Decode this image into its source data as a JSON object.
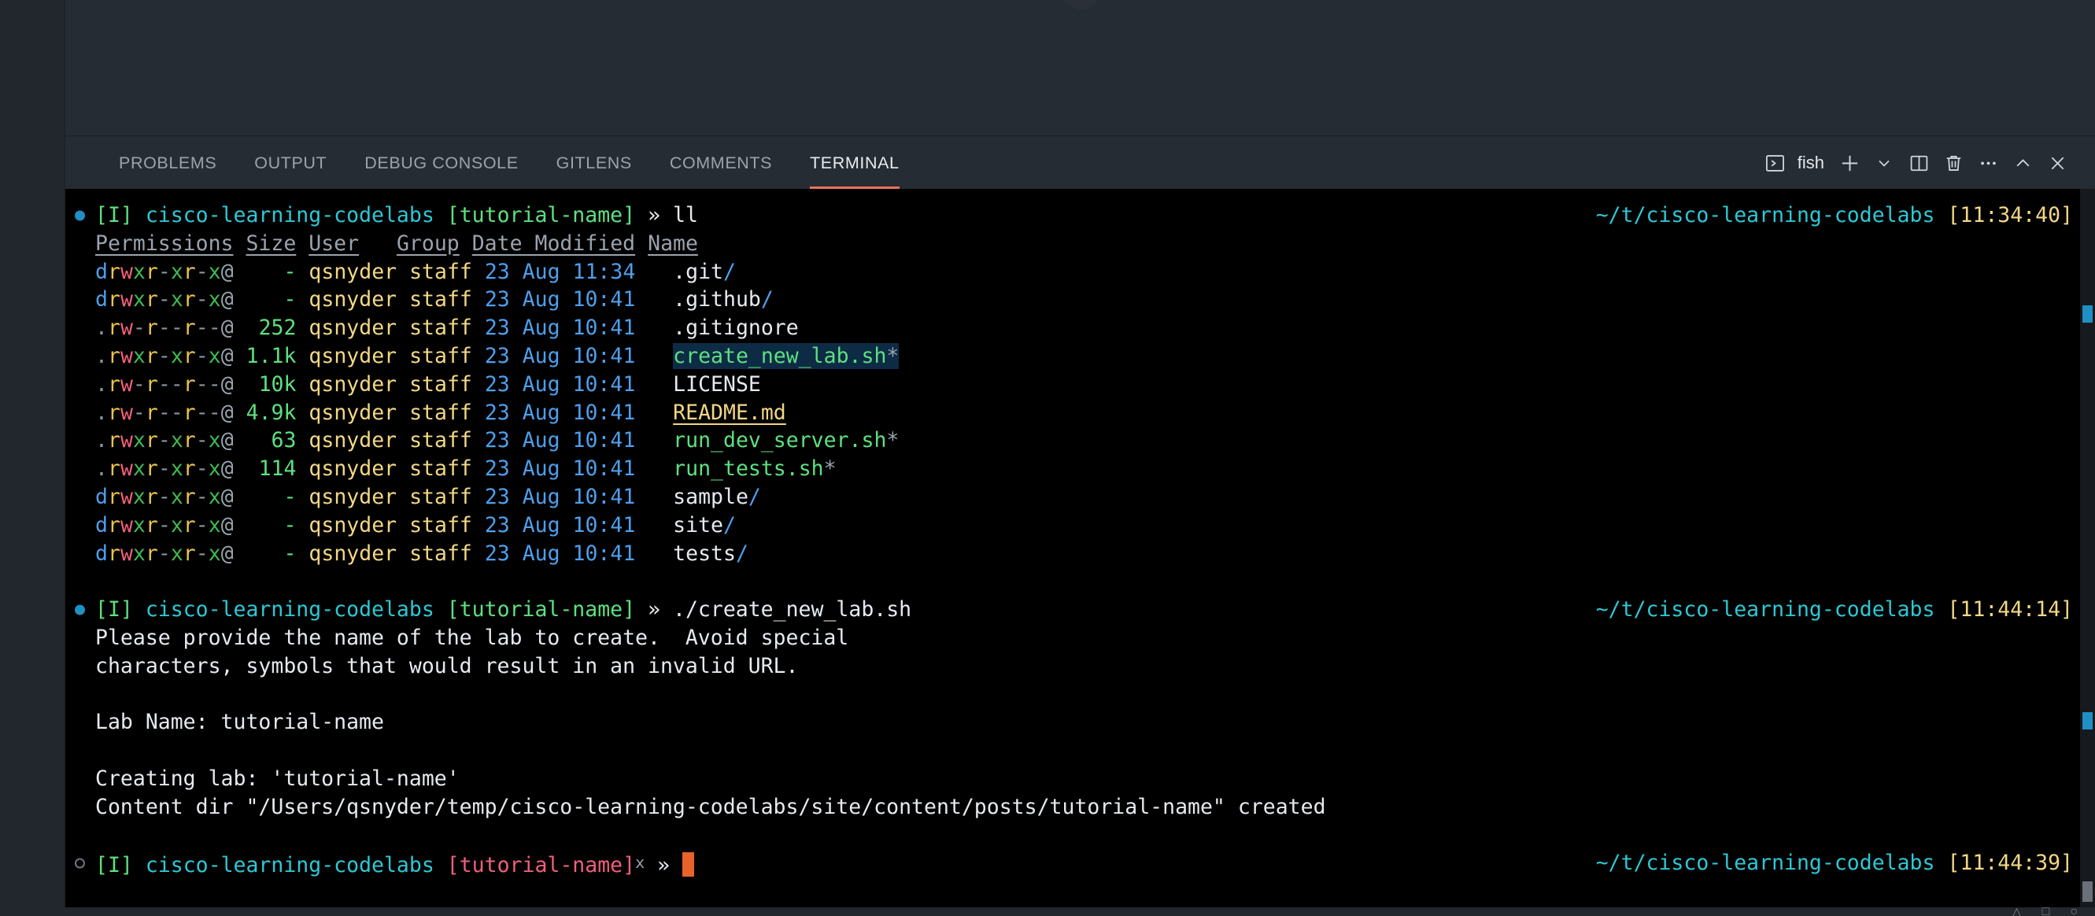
{
  "window": {
    "theme_bg": "#22272e",
    "panel_bg": "#262c33",
    "terminal_bg": "#000000",
    "accent": "#e8765a"
  },
  "panel": {
    "tabs": [
      {
        "label": "PROBLEMS",
        "active": false
      },
      {
        "label": "OUTPUT",
        "active": false
      },
      {
        "label": "DEBUG CONSOLE",
        "active": false
      },
      {
        "label": "GITLENS",
        "active": false
      },
      {
        "label": "COMMENTS",
        "active": false
      },
      {
        "label": "TERMINAL",
        "active": true
      }
    ],
    "actions": {
      "shell_label": "fish",
      "shell_icon": "terminal-icon",
      "new_terminal_icon": "plus-icon",
      "new_terminal_dropdown_icon": "chevron-down-icon",
      "split_terminal_icon": "split-editor-icon",
      "kill_terminal_icon": "trash-icon",
      "more_actions_icon": "ellipsis-icon",
      "maximize_panel_icon": "chevron-up-icon",
      "close_panel_icon": "close-icon"
    }
  },
  "terminal": {
    "prompt": {
      "mode": "[I]",
      "repo": "cisco-learning-codelabs",
      "branch_clean": "[tutorial-name]",
      "branch_dirty": "[tutorial-name]",
      "branch_dirty_mark": "x",
      "arrow": "»",
      "cwd": "~/t/cisco-learning-codelabs"
    },
    "blocks": [
      {
        "command": "ll",
        "timestamp": "[11:34:40]",
        "status": "done",
        "table": {
          "headers": [
            "Permissions",
            "Size",
            "User",
            "Group",
            "Date Modified",
            "Name"
          ],
          "rows": [
            {
              "perm": "drwxr-xr-x@",
              "size": "-",
              "user": "qsnyder",
              "group": "staff",
              "date": "23 Aug 11:34",
              "name": ".git",
              "kind": "dir"
            },
            {
              "perm": "drwxr-xr-x@",
              "size": "-",
              "user": "qsnyder",
              "group": "staff",
              "date": "23 Aug 10:41",
              "name": ".github",
              "kind": "dir"
            },
            {
              "perm": ".rw-r--r--@",
              "size": "252",
              "user": "qsnyder",
              "group": "staff",
              "date": "23 Aug 10:41",
              "name": ".gitignore",
              "kind": "file"
            },
            {
              "perm": ".rwxr-xr-x@",
              "size": "1.1k",
              "user": "qsnyder",
              "group": "staff",
              "date": "23 Aug 10:41",
              "name": "create_new_lab.sh",
              "kind": "exec",
              "selected": true
            },
            {
              "perm": ".rw-r--r--@",
              "size": "10k",
              "user": "qsnyder",
              "group": "staff",
              "date": "23 Aug 10:41",
              "name": "LICENSE",
              "kind": "file"
            },
            {
              "perm": ".rw-r--r--@",
              "size": "4.9k",
              "user": "qsnyder",
              "group": "staff",
              "date": "23 Aug 10:41",
              "name": "README.md",
              "kind": "link"
            },
            {
              "perm": ".rwxr-xr-x@",
              "size": "63",
              "user": "qsnyder",
              "group": "staff",
              "date": "23 Aug 10:41",
              "name": "run_dev_server.sh",
              "kind": "exec"
            },
            {
              "perm": ".rwxr-xr-x@",
              "size": "114",
              "user": "qsnyder",
              "group": "staff",
              "date": "23 Aug 10:41",
              "name": "run_tests.sh",
              "kind": "exec"
            },
            {
              "perm": "drwxr-xr-x@",
              "size": "-",
              "user": "qsnyder",
              "group": "staff",
              "date": "23 Aug 10:41",
              "name": "sample",
              "kind": "dir"
            },
            {
              "perm": "drwxr-xr-x@",
              "size": "-",
              "user": "qsnyder",
              "group": "staff",
              "date": "23 Aug 10:41",
              "name": "site",
              "kind": "dir"
            },
            {
              "perm": "drwxr-xr-x@",
              "size": "-",
              "user": "qsnyder",
              "group": "staff",
              "date": "23 Aug 10:41",
              "name": "tests",
              "kind": "dir"
            }
          ]
        }
      },
      {
        "command": "./create_new_lab.sh",
        "timestamp": "[11:44:14]",
        "status": "done",
        "output": [
          "Please provide the name of the lab to create.  Avoid special",
          "characters, symbols that would result in an invalid URL.",
          "",
          "Lab Name: tutorial-name",
          "",
          "Creating lab: 'tutorial-name'",
          "Content dir \"/Users/qsnyder/temp/cisco-learning-codelabs/site/content/posts/tutorial-name\" created"
        ]
      },
      {
        "command": "",
        "timestamp": "[11:44:39]",
        "status": "pending",
        "output": []
      }
    ]
  }
}
